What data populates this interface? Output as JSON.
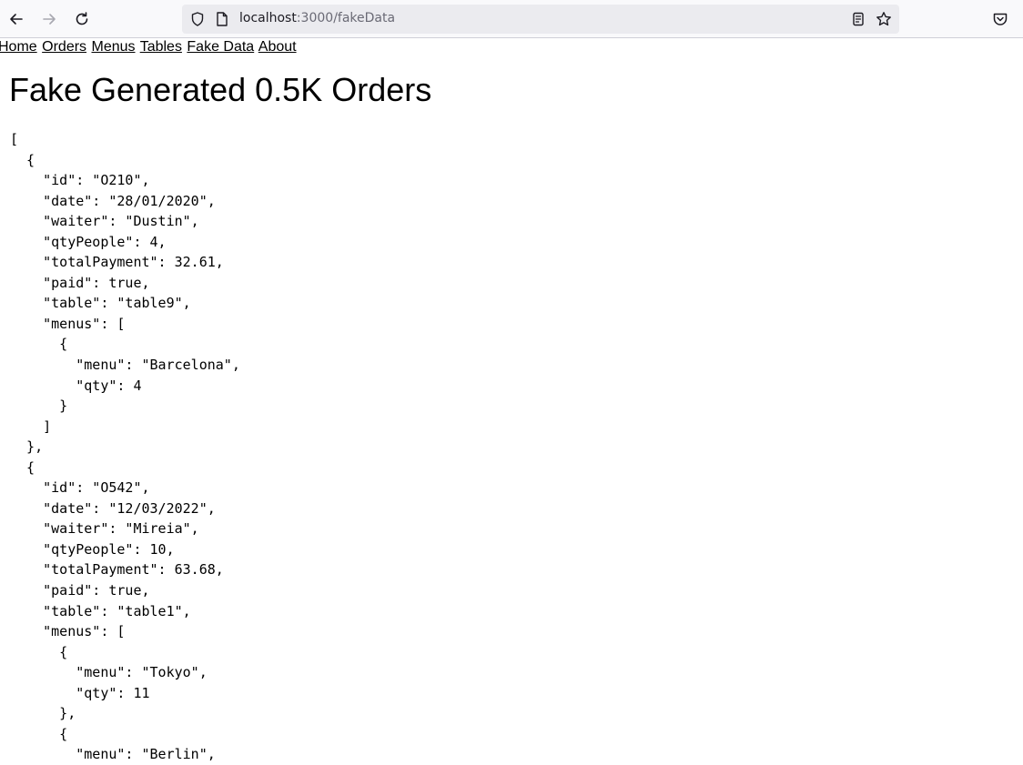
{
  "browser": {
    "url_host": "localhost",
    "url_path": ":3000/fakeData"
  },
  "nav": {
    "home": "Home",
    "orders": "Orders",
    "menus": "Menus",
    "tables": "Tables",
    "fake_data": "Fake Data",
    "about": "About"
  },
  "page": {
    "title": "Fake Generated 0.5K Orders"
  },
  "json_lines": [
    "[",
    "  {",
    "    \"id\": \"O210\",",
    "    \"date\": \"28/01/2020\",",
    "    \"waiter\": \"Dustin\",",
    "    \"qtyPeople\": 4,",
    "    \"totalPayment\": 32.61,",
    "    \"paid\": true,",
    "    \"table\": \"table9\",",
    "    \"menus\": [",
    "      {",
    "        \"menu\": \"Barcelona\",",
    "        \"qty\": 4",
    "      }",
    "    ]",
    "  },",
    "  {",
    "    \"id\": \"O542\",",
    "    \"date\": \"12/03/2022\",",
    "    \"waiter\": \"Mireia\",",
    "    \"qtyPeople\": 10,",
    "    \"totalPayment\": 63.68,",
    "    \"paid\": true,",
    "    \"table\": \"table1\",",
    "    \"menus\": [",
    "      {",
    "        \"menu\": \"Tokyo\",",
    "        \"qty\": 11",
    "      },",
    "      {",
    "        \"menu\": \"Berlin\","
  ],
  "icons": {
    "back": "back-arrow-icon",
    "forward": "forward-arrow-icon",
    "reload": "reload-icon",
    "tracking": "shield-icon",
    "page": "page-icon",
    "reader": "reader-view-icon",
    "bookmark": "star-icon",
    "pocket": "pocket-icon"
  }
}
